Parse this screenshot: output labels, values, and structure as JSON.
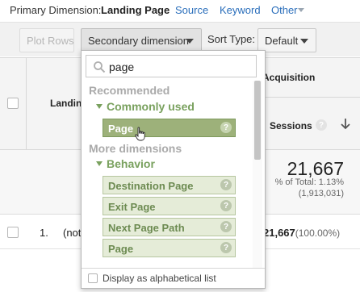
{
  "primary": {
    "label": "Primary Dimension:",
    "active": "Landing Page",
    "links": [
      "Source",
      "Keyword",
      "Other"
    ]
  },
  "toolbar": {
    "plot_rows": "Plot Rows",
    "secondary_dimension": "Secondary dimension",
    "sort_type_label": "Sort Type:",
    "sort_type_value": "Default"
  },
  "table": {
    "landing_header": "Landing",
    "acquisition_header": "Acquisition",
    "sessions_header": "Sessions",
    "totals": {
      "value": "21,667",
      "pct": "% of Total: 1.13%",
      "abs": "(1,913,031)"
    },
    "rows": [
      {
        "num": "1.",
        "name": "(not",
        "sessions": "21,667",
        "pct": "(100.00%)"
      }
    ]
  },
  "dropdown": {
    "search_value": "page",
    "recommended": "Recommended",
    "commonly_used": "Commonly used",
    "commonly_items": [
      "Page"
    ],
    "more_dimensions": "More dimensions",
    "behavior": "Behavior",
    "behavior_items": [
      "Destination Page",
      "Exit Page",
      "Next Page Path",
      "Page"
    ],
    "footer_label": "Display as alphabetical list"
  },
  "colors": {
    "link": "#2a6ebb",
    "group_green": "#79a15e",
    "selected_item": "#9db17a"
  }
}
